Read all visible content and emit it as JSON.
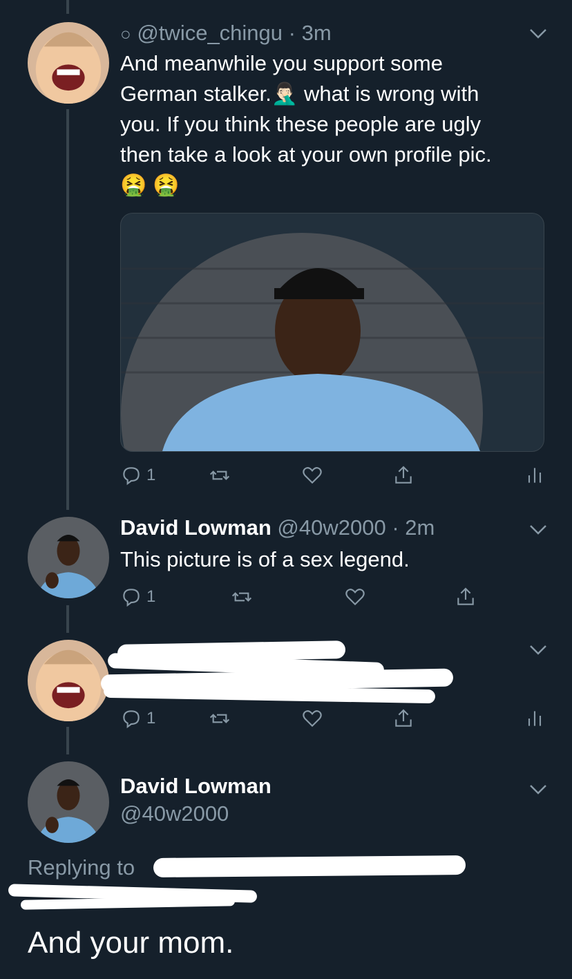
{
  "tweet1": {
    "handle": "@twice_chingu",
    "time": "3m",
    "text_1": "And meanwhile you support some",
    "text_2a": "German stalker.",
    "emoji_facepalm": "🤦🏻‍♂️",
    "text_2b": "what is wrong with",
    "text_3": "you. If you think these people are ugly",
    "text_4": "then take a look at your own profile pic.",
    "text_5": "🤮 🤮",
    "replies": "1"
  },
  "tweet2": {
    "name": "David Lowman",
    "handle": "@40w2000",
    "time": "2m",
    "text": "This picture is of a sex legend.",
    "replies": "1"
  },
  "tweet3": {
    "replies": "1"
  },
  "tweet4": {
    "name": "David Lowman",
    "handle": "@40w2000",
    "replying_to_label": "Replying to",
    "text": "And your mom."
  },
  "icons": [
    "reply-icon",
    "retweet-icon",
    "like-icon",
    "share-icon",
    "analytics-icon",
    "chevron-down-icon"
  ],
  "colors": {
    "background": "#15202b",
    "secondary_text": "#8899a6",
    "link": "#1da1f2",
    "thread_line": "#38444d"
  }
}
